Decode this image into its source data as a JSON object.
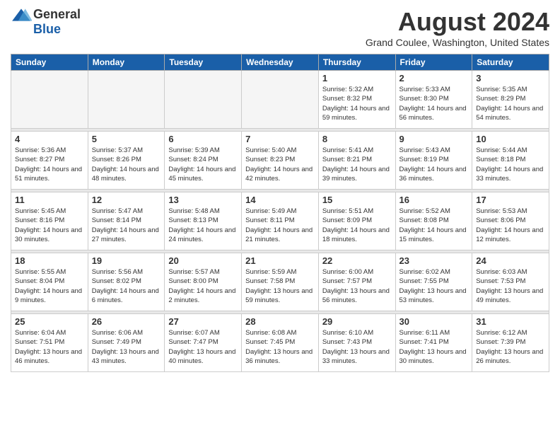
{
  "logo": {
    "general": "General",
    "blue": "Blue"
  },
  "header": {
    "title": "August 2024",
    "subtitle": "Grand Coulee, Washington, United States"
  },
  "weekdays": [
    "Sunday",
    "Monday",
    "Tuesday",
    "Wednesday",
    "Thursday",
    "Friday",
    "Saturday"
  ],
  "weeks": [
    [
      {
        "day": "",
        "empty": true
      },
      {
        "day": "",
        "empty": true
      },
      {
        "day": "",
        "empty": true
      },
      {
        "day": "",
        "empty": true
      },
      {
        "day": "1",
        "sunrise": "5:32 AM",
        "sunset": "8:32 PM",
        "daylight": "14 hours and 59 minutes."
      },
      {
        "day": "2",
        "sunrise": "5:33 AM",
        "sunset": "8:30 PM",
        "daylight": "14 hours and 56 minutes."
      },
      {
        "day": "3",
        "sunrise": "5:35 AM",
        "sunset": "8:29 PM",
        "daylight": "14 hours and 54 minutes."
      }
    ],
    [
      {
        "day": "4",
        "sunrise": "5:36 AM",
        "sunset": "8:27 PM",
        "daylight": "14 hours and 51 minutes."
      },
      {
        "day": "5",
        "sunrise": "5:37 AM",
        "sunset": "8:26 PM",
        "daylight": "14 hours and 48 minutes."
      },
      {
        "day": "6",
        "sunrise": "5:39 AM",
        "sunset": "8:24 PM",
        "daylight": "14 hours and 45 minutes."
      },
      {
        "day": "7",
        "sunrise": "5:40 AM",
        "sunset": "8:23 PM",
        "daylight": "14 hours and 42 minutes."
      },
      {
        "day": "8",
        "sunrise": "5:41 AM",
        "sunset": "8:21 PM",
        "daylight": "14 hours and 39 minutes."
      },
      {
        "day": "9",
        "sunrise": "5:43 AM",
        "sunset": "8:19 PM",
        "daylight": "14 hours and 36 minutes."
      },
      {
        "day": "10",
        "sunrise": "5:44 AM",
        "sunset": "8:18 PM",
        "daylight": "14 hours and 33 minutes."
      }
    ],
    [
      {
        "day": "11",
        "sunrise": "5:45 AM",
        "sunset": "8:16 PM",
        "daylight": "14 hours and 30 minutes."
      },
      {
        "day": "12",
        "sunrise": "5:47 AM",
        "sunset": "8:14 PM",
        "daylight": "14 hours and 27 minutes."
      },
      {
        "day": "13",
        "sunrise": "5:48 AM",
        "sunset": "8:13 PM",
        "daylight": "14 hours and 24 minutes."
      },
      {
        "day": "14",
        "sunrise": "5:49 AM",
        "sunset": "8:11 PM",
        "daylight": "14 hours and 21 minutes."
      },
      {
        "day": "15",
        "sunrise": "5:51 AM",
        "sunset": "8:09 PM",
        "daylight": "14 hours and 18 minutes."
      },
      {
        "day": "16",
        "sunrise": "5:52 AM",
        "sunset": "8:08 PM",
        "daylight": "14 hours and 15 minutes."
      },
      {
        "day": "17",
        "sunrise": "5:53 AM",
        "sunset": "8:06 PM",
        "daylight": "14 hours and 12 minutes."
      }
    ],
    [
      {
        "day": "18",
        "sunrise": "5:55 AM",
        "sunset": "8:04 PM",
        "daylight": "14 hours and 9 minutes."
      },
      {
        "day": "19",
        "sunrise": "5:56 AM",
        "sunset": "8:02 PM",
        "daylight": "14 hours and 6 minutes."
      },
      {
        "day": "20",
        "sunrise": "5:57 AM",
        "sunset": "8:00 PM",
        "daylight": "14 hours and 2 minutes."
      },
      {
        "day": "21",
        "sunrise": "5:59 AM",
        "sunset": "7:58 PM",
        "daylight": "13 hours and 59 minutes."
      },
      {
        "day": "22",
        "sunrise": "6:00 AM",
        "sunset": "7:57 PM",
        "daylight": "13 hours and 56 minutes."
      },
      {
        "day": "23",
        "sunrise": "6:02 AM",
        "sunset": "7:55 PM",
        "daylight": "13 hours and 53 minutes."
      },
      {
        "day": "24",
        "sunrise": "6:03 AM",
        "sunset": "7:53 PM",
        "daylight": "13 hours and 49 minutes."
      }
    ],
    [
      {
        "day": "25",
        "sunrise": "6:04 AM",
        "sunset": "7:51 PM",
        "daylight": "13 hours and 46 minutes."
      },
      {
        "day": "26",
        "sunrise": "6:06 AM",
        "sunset": "7:49 PM",
        "daylight": "13 hours and 43 minutes."
      },
      {
        "day": "27",
        "sunrise": "6:07 AM",
        "sunset": "7:47 PM",
        "daylight": "13 hours and 40 minutes."
      },
      {
        "day": "28",
        "sunrise": "6:08 AM",
        "sunset": "7:45 PM",
        "daylight": "13 hours and 36 minutes."
      },
      {
        "day": "29",
        "sunrise": "6:10 AM",
        "sunset": "7:43 PM",
        "daylight": "13 hours and 33 minutes."
      },
      {
        "day": "30",
        "sunrise": "6:11 AM",
        "sunset": "7:41 PM",
        "daylight": "13 hours and 30 minutes."
      },
      {
        "day": "31",
        "sunrise": "6:12 AM",
        "sunset": "7:39 PM",
        "daylight": "13 hours and 26 minutes."
      }
    ]
  ],
  "labels": {
    "sunrise": "Sunrise:",
    "sunset": "Sunset:",
    "daylight": "Daylight:"
  }
}
